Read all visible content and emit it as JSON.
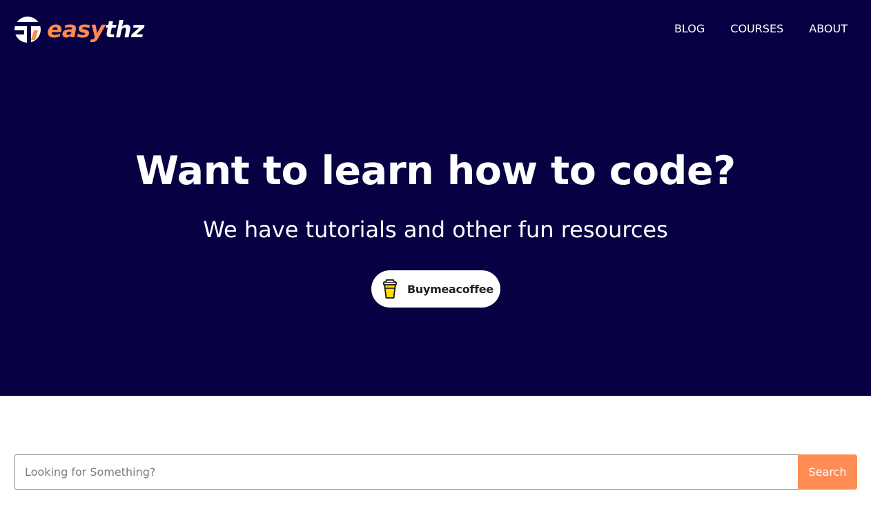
{
  "brand": {
    "name_part1": "easy",
    "name_part2": "thz",
    "logo_icon": "et-logo-mark",
    "colors": {
      "accent": "#ff8b4f",
      "hero_bg": "#070042"
    }
  },
  "nav": {
    "items": [
      {
        "label": "BLOG"
      },
      {
        "label": "COURSES"
      },
      {
        "label": "ABOUT"
      }
    ]
  },
  "hero": {
    "headline": "Want to learn how to code?",
    "subheadline": "We have tutorials and other fun resources",
    "cta": {
      "label": "Buymeacoffee",
      "icon": "coffee-cup-icon"
    }
  },
  "search": {
    "placeholder": "Looking for Something?",
    "value": "",
    "button_label": "Search"
  }
}
